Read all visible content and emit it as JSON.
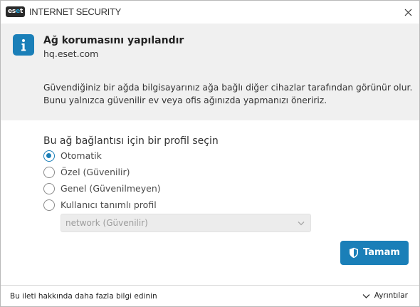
{
  "window": {
    "logo_text_1": "es",
    "logo_text_2": "e",
    "logo_text_3": "t",
    "app_title": "INTERNET SECURITY",
    "close_icon": "close-icon"
  },
  "header": {
    "icon": "info-icon",
    "title": "Ağ korumasını yapılandır",
    "network_name": "hq.eset.com"
  },
  "description": {
    "line1": "Güvendiğiniz bir ağda bilgisayarınız ağa bağlı diğer cihazlar tarafından görünür olur.",
    "line2": "Bunu yalnızca güvenilir ev veya ofis ağınızda yapmanızı öneririz."
  },
  "profile": {
    "label": "Bu ağ bağlantısı için bir profil seçin",
    "options": [
      {
        "label": "Otomatik",
        "checked": true
      },
      {
        "label": "Özel (Güvenilir)",
        "checked": false
      },
      {
        "label": "Genel (Güvenilmeyen)",
        "checked": false
      },
      {
        "label": "Kullanıcı tanımlı profil",
        "checked": false
      }
    ],
    "custom_select_value": "network (Güvenilir)"
  },
  "actions": {
    "ok_label": "Tamam",
    "ok_icon": "shield-icon"
  },
  "footer": {
    "more_info_link": "Bu ileti hakkında daha fazla bilgi edinin",
    "details_label": "Ayrıntılar",
    "details_icon": "chevron-down-icon"
  },
  "colors": {
    "accent": "#1a7fb8",
    "header_bg": "#f0f0f0"
  }
}
